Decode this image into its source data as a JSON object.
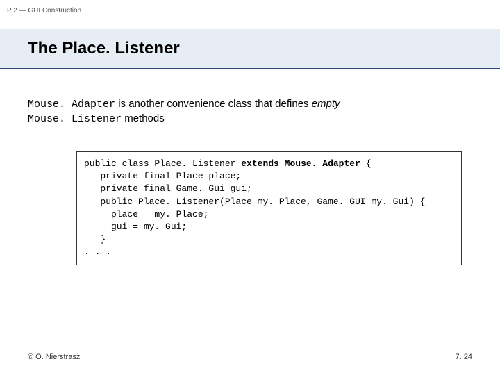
{
  "topic": "P 2 — GUI Construction",
  "title": "The Place. Listener",
  "intro": {
    "mono1": "Mouse. Adapter",
    "text1": " is another convenience class that defines ",
    "ital1": "empty",
    "linebreak": "",
    "mono2": "Mouse. Listener",
    "text2": " methods"
  },
  "code": {
    "l1a": "public class Place. Listener ",
    "l1b": "extends Mouse. Adapter",
    "l1c": " {",
    "l2": "   private final Place place;",
    "l3": "   private final Game. Gui gui;",
    "l4": "   public Place. Listener(Place my. Place, Game. GUI my. Gui) {",
    "l5": "     place = my. Place;",
    "l6": "     gui = my. Gui;",
    "l7": "   }",
    "l8": ". . ."
  },
  "footer": {
    "copyright": "© O. Nierstrasz",
    "page": "7. 24"
  }
}
